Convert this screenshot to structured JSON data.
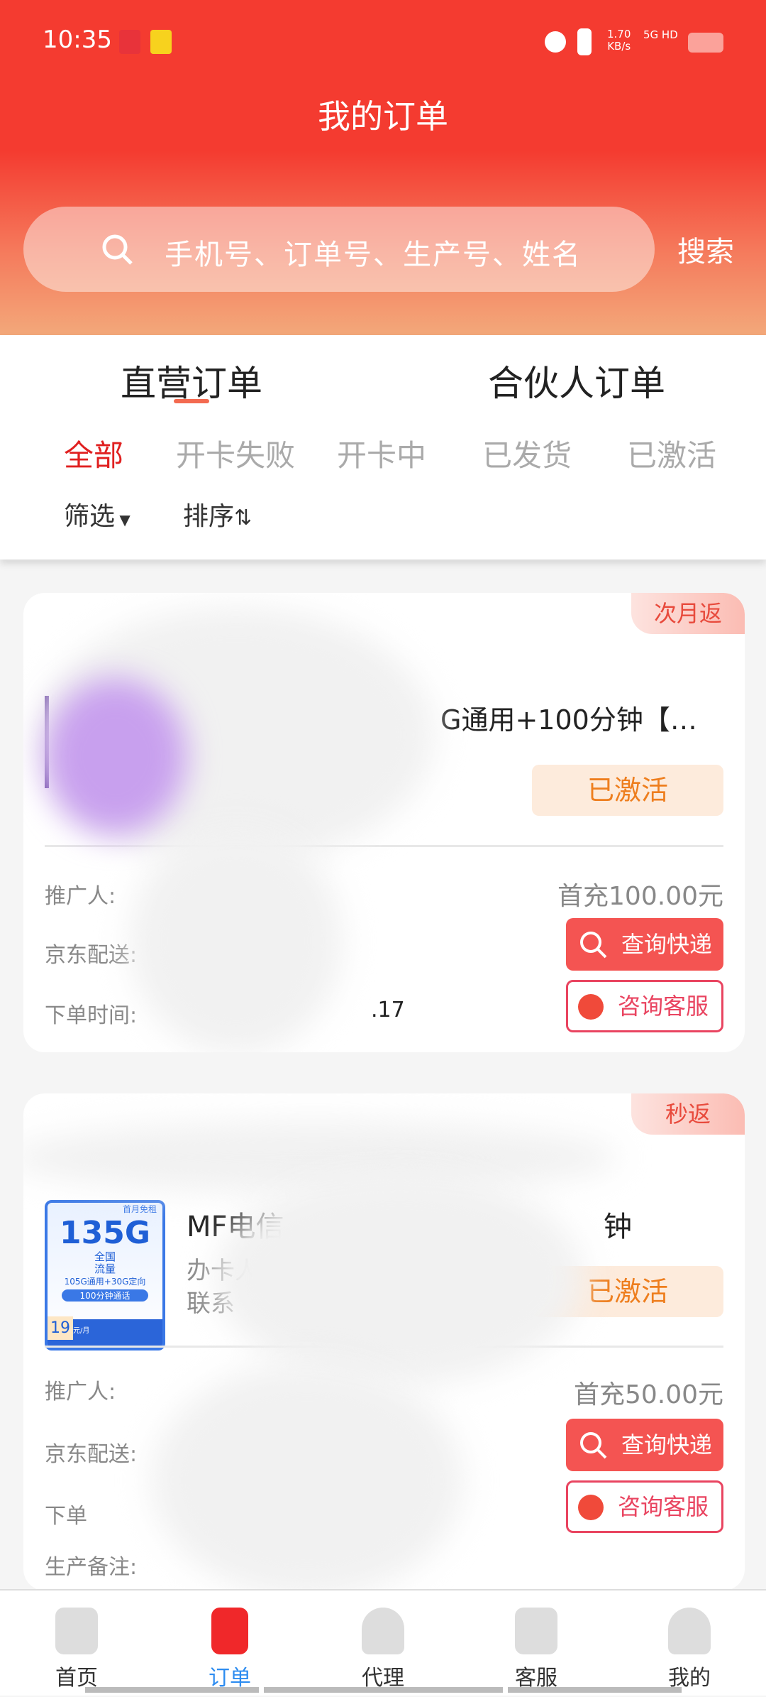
{
  "status_bar": {
    "time": "10:35",
    "net_speed": "1.70",
    "net_unit": "KB/s",
    "network": "5G HD"
  },
  "header": {
    "title": "我的订单",
    "search_placeholder": "手机号、订单号、生产号、姓名",
    "search_button": "搜索"
  },
  "main_tabs": [
    {
      "label": "直营订单",
      "active": true
    },
    {
      "label": "合伙人订单",
      "active": false
    }
  ],
  "filter_tabs": [
    {
      "label": "全部",
      "active": true
    },
    {
      "label": "开卡失败"
    },
    {
      "label": "开卡中"
    },
    {
      "label": "已发货"
    },
    {
      "label": "已激活"
    }
  ],
  "toolbar": {
    "filter": "筛选",
    "sort": "排序"
  },
  "orders": [
    {
      "badge": "次月返",
      "title_fragment": "G通用+100分钟【…",
      "status": "已激活",
      "promoter_label": "推广人:",
      "delivery_label": "京东配送:",
      "time_label": "下单时间:",
      "time_fragment": ".17",
      "price": "首充100.00元",
      "track_button": "查询快递",
      "service_button": "咨询客服"
    },
    {
      "badge": "秒返",
      "title_fragment_start": "MF电信",
      "title_fragment_end": "钟",
      "applicant_fragment": "办卡人",
      "contact_fragment": "联系",
      "status": "已激活",
      "promoter_label": "推广人:",
      "delivery_label": "京东配送:",
      "time_fragment": "下单",
      "remark_label": "生产备注:",
      "price": "首充50.00元",
      "track_button": "查询快递",
      "service_button": "咨询客服",
      "image": {
        "headline": "135G",
        "tag1": "全国",
        "tag2": "流量",
        "detail": "105G通用+30G定向",
        "minutes": "100分钟通话",
        "price": "19",
        "unit": "元/月",
        "top": "首月免租"
      }
    }
  ],
  "bottom_nav": [
    {
      "label": "首页"
    },
    {
      "label": "订单",
      "active": true
    },
    {
      "label": "代理"
    },
    {
      "label": "客服"
    },
    {
      "label": "我的"
    }
  ],
  "colors": {
    "primary": "#f43b30",
    "active_tab": "#e02020",
    "nav_active": "#2d8cf0",
    "status_bg": "#fdebdc",
    "status_text": "#ee7e1e"
  }
}
